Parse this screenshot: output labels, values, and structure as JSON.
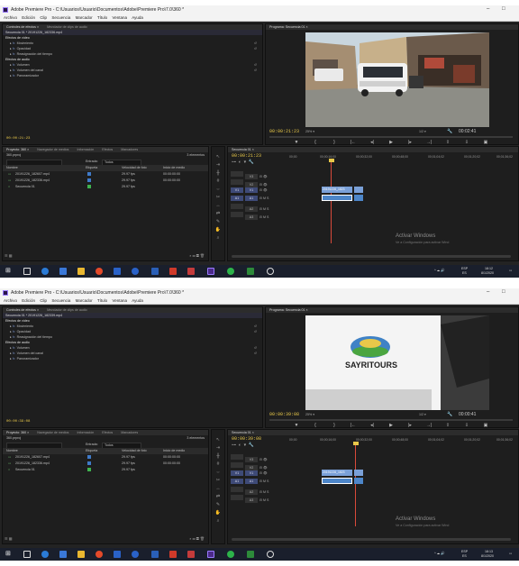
{
  "app": {
    "title": "Adobe Premiere Pro - C:\\Usuarios\\Usuario\\Documentos\\Adobe\\Premiere Pro\\7.0\\360 *",
    "menu": [
      "Archivo",
      "Edición",
      "Clip",
      "Secuencia",
      "Marcador",
      "Título",
      "Ventana",
      "Ayuda"
    ]
  },
  "effects_panel": {
    "tabs": [
      "Controles de efectos ×",
      "Mezclador de clips de audio"
    ],
    "header": "Secuencia 01 * 20191226_182336.mp4",
    "header2": "Secuencia 01 * 20191226_182339.mp4",
    "video_section": "Efectos de vídeo",
    "items": [
      "Movimiento",
      "Opacidad",
      "Reasignación del tiempo"
    ],
    "audio_section": "Efectos de audio",
    "audio_items": [
      "Volumen",
      "Volumen del canal",
      "Panoramizador"
    ],
    "timecode1": "00:00:21:23",
    "timecode2": "00:00:39:08"
  },
  "program_monitor": {
    "tab": "Programa: Secuencia 01 ×",
    "timecode1": "00:00:21:23",
    "timecode2": "00:00:39:08",
    "zoom": "25%",
    "fraction": "1/2",
    "end_tc1": "00:02:41",
    "end_tc2": "00:00:41",
    "logo_text": "SAYRITOURS"
  },
  "project_panel": {
    "tabs": [
      "Proyecto: 360 ×",
      "Navegador de medios",
      "Información",
      "Efectos",
      "Marcadores"
    ],
    "file": "360.prproj",
    "count": "3 elementos",
    "search_label": "Entrada:",
    "search_value": "Todos",
    "columns": [
      "Nombre",
      "Etiqueta",
      "Velocidad de foto",
      "Inicio de medio"
    ],
    "rows": [
      {
        "name": "20191226_182607.mp4",
        "label": "#3f7ac9",
        "fps": "29.97 fps",
        "start": "00:00:00:00"
      },
      {
        "name": "20191226_182336.mp4",
        "label": "#3f7ac9",
        "fps": "29.97 fps",
        "start": "00:00:00:00"
      },
      {
        "name": "Secuencia 01",
        "label": "#3fb34f",
        "fps": "29.97 fps",
        "start": ""
      }
    ]
  },
  "timeline": {
    "tab": "Secuencia 01 ×",
    "timecode1": "00:00:21:23",
    "timecode2": "00:00:39:08",
    "ruler": [
      "00;00",
      "00;00;16;00",
      "00;00;32;00",
      "00;00;48;00",
      "00;01;04;02",
      "00;01;20;02",
      "00;01;36;02"
    ],
    "tracks": [
      "V3",
      "V2",
      "V1",
      "A1",
      "A2",
      "A3"
    ],
    "clip_video": "20191226_1823",
    "clip_audio": "20191226"
  },
  "watermark": {
    "line1": "Activar Windows",
    "line2": "Ve a Configuración para activar Wind"
  },
  "taskbar": {
    "lang": "ESP",
    "region": "ES",
    "time1": "18:12",
    "time2": "18:13",
    "date": "8/1/2020"
  },
  "colors": {
    "accent": "#e8c84a",
    "playhead": "#d94a3a",
    "clip_video": "#7aa0d8",
    "clip_audio": "#4d86c9"
  }
}
